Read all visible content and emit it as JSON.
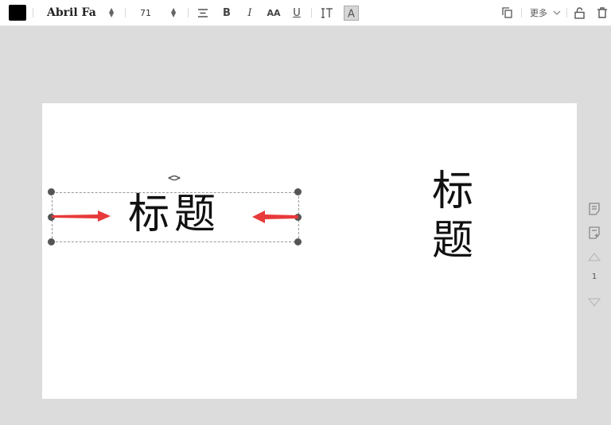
{
  "toolbar": {
    "text_color": "#000000",
    "font_family": "Abril Fa",
    "font_size": "71",
    "bold": "B",
    "italic": "I",
    "uppercase": "AA",
    "underline": "U",
    "more_label": "更多",
    "icons": {
      "align": "align-center-icon",
      "line_height": "line-height-icon",
      "text_background": "text-background-icon",
      "copy": "copy-icon",
      "chevron": "chevron-down-icon",
      "lock": "lock-icon",
      "delete": "trash-icon"
    }
  },
  "canvas": {
    "selected_text": "标题",
    "vertical_text": [
      "标",
      "题"
    ],
    "annotation_color": "#e83a3a"
  },
  "right_rail": {
    "page_number": "1",
    "icons": [
      "page-icon",
      "add-page-icon",
      "page-up-icon",
      "page-down-icon"
    ]
  }
}
